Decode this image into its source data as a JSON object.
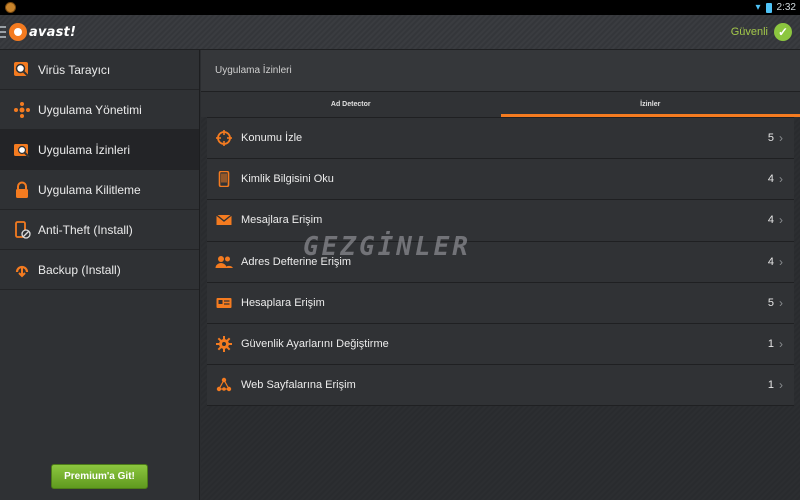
{
  "status_bar": {
    "time": "2:32"
  },
  "app": {
    "logo_text": "avast!",
    "status_label": "Güvenli"
  },
  "sidebar": {
    "items": [
      {
        "label": "Virüs Tarayıcı",
        "icon": "virus-scanner-icon"
      },
      {
        "label": "Uygulama Yönetimi",
        "icon": "app-manager-icon"
      },
      {
        "label": "Uygulama İzinleri",
        "icon": "app-permissions-icon",
        "active": true
      },
      {
        "label": "Uygulama Kilitleme",
        "icon": "app-lock-icon"
      },
      {
        "label": "Anti-Theft (Install)",
        "icon": "anti-theft-icon"
      },
      {
        "label": "Backup (Install)",
        "icon": "backup-icon"
      }
    ],
    "premium_button": "Premium'a Git!"
  },
  "main": {
    "title": "Uygulama İzinleri",
    "tabs": [
      {
        "label": "Ad Detector",
        "active": false
      },
      {
        "label": "İzinler",
        "active": true
      }
    ],
    "permissions": [
      {
        "label": "Konumu İzle",
        "count": "5",
        "icon": "location-crosshair-icon"
      },
      {
        "label": "Kimlik Bilgisini Oku",
        "count": "4",
        "icon": "phone-icon"
      },
      {
        "label": "Mesajlara Erişim",
        "count": "4",
        "icon": "envelope-icon"
      },
      {
        "label": "Adres Defterine Erişim",
        "count": "4",
        "icon": "contacts-icon"
      },
      {
        "label": "Hesaplara Erişim",
        "count": "5",
        "icon": "id-card-icon"
      },
      {
        "label": "Güvenlik Ayarlarını Değiştirme",
        "count": "1",
        "icon": "gear-icon"
      },
      {
        "label": "Web Sayfalarına Erişim",
        "count": "1",
        "icon": "web-network-icon"
      }
    ]
  },
  "watermark": "GEZGİNLER",
  "colors": {
    "accent": "#f47b20",
    "safe": "#8cc63f",
    "premium": "#6fae2a"
  }
}
